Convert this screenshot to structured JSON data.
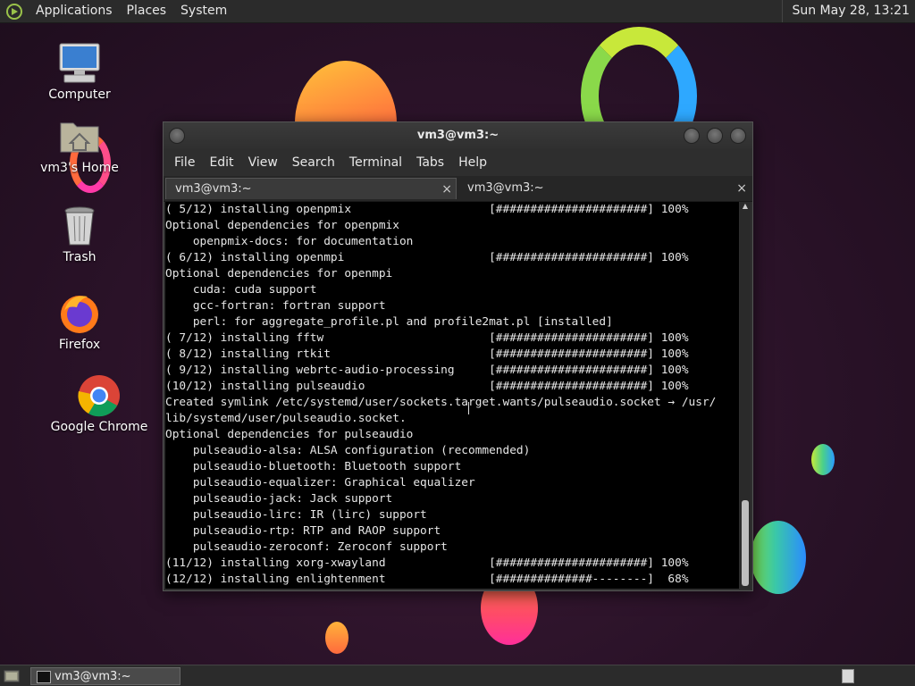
{
  "top_panel": {
    "menus": [
      "Applications",
      "Places",
      "System"
    ],
    "clock": "Sun May 28, 13:21"
  },
  "desktop": {
    "icons": [
      {
        "label": "Computer",
        "icon": "computer-icon"
      },
      {
        "label": "vm3's Home",
        "icon": "home-folder-icon"
      },
      {
        "label": "Trash",
        "icon": "trash-icon"
      },
      {
        "label": "Firefox",
        "icon": "firefox-icon"
      },
      {
        "label": "Google Chrome",
        "icon": "chrome-icon"
      }
    ]
  },
  "terminal": {
    "title": "vm3@vm3:~",
    "menu": [
      "File",
      "Edit",
      "View",
      "Search",
      "Terminal",
      "Tabs",
      "Help"
    ],
    "tabs": [
      {
        "label": "vm3@vm3:~",
        "close": "×"
      },
      {
        "label": "vm3@vm3:~",
        "close": "×"
      }
    ],
    "lines": [
      "( 5/12) installing openpmix                    [######################] 100%",
      "Optional dependencies for openpmix",
      "    openpmix-docs: for documentation",
      "( 6/12) installing openmpi                     [######################] 100%",
      "Optional dependencies for openmpi",
      "    cuda: cuda support",
      "    gcc-fortran: fortran support",
      "    perl: for aggregate_profile.pl and profile2mat.pl [installed]",
      "( 7/12) installing fftw                        [######################] 100%",
      "( 8/12) installing rtkit                       [######################] 100%",
      "( 9/12) installing webrtc-audio-processing     [######################] 100%",
      "(10/12) installing pulseaudio                  [######################] 100%",
      "Created symlink /etc/systemd/user/sockets.target.wants/pulseaudio.socket → /usr/",
      "lib/systemd/user/pulseaudio.socket.",
      "Optional dependencies for pulseaudio",
      "    pulseaudio-alsa: ALSA configuration (recommended)",
      "    pulseaudio-bluetooth: Bluetooth support",
      "    pulseaudio-equalizer: Graphical equalizer",
      "    pulseaudio-jack: Jack support",
      "    pulseaudio-lirc: IR (lirc) support",
      "    pulseaudio-rtp: RTP and RAOP support",
      "    pulseaudio-zeroconf: Zeroconf support",
      "(11/12) installing xorg-xwayland               [######################] 100%",
      "(12/12) installing enlightenment               [##############--------]  68%"
    ]
  },
  "taskbar": {
    "window_label": "vm3@vm3:~"
  }
}
